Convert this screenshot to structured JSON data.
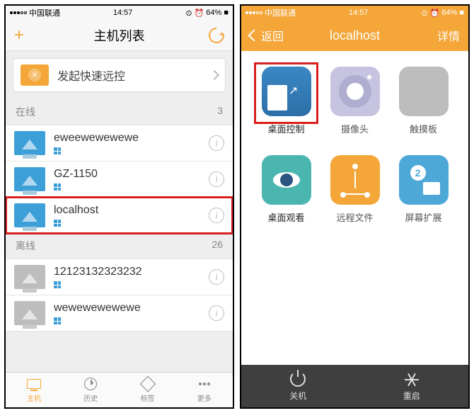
{
  "status": {
    "carrier": "中国联通",
    "time": "14:57",
    "battery": "64%"
  },
  "left": {
    "nav_title": "主机列表",
    "quick_label": "发起快速远控",
    "section_online": "在线",
    "count_online": "3",
    "section_offline": "离线",
    "count_offline": "26",
    "hosts_online": [
      {
        "name": "eweewewewewe"
      },
      {
        "name": "GZ-1150"
      },
      {
        "name": "localhost"
      }
    ],
    "hosts_offline": [
      {
        "name": "12123132323232"
      },
      {
        "name": "wewewewewewe"
      }
    ],
    "tabs": [
      {
        "label": "主机"
      },
      {
        "label": "历史"
      },
      {
        "label": "标签"
      },
      {
        "label": "更多"
      }
    ]
  },
  "right": {
    "back": "返回",
    "title": "localhost",
    "detail": "详情",
    "grid": [
      {
        "label": "桌面控制"
      },
      {
        "label": "摄像头"
      },
      {
        "label": "触摸板"
      },
      {
        "label": "桌面观看"
      },
      {
        "label": "远程文件"
      },
      {
        "label": "屏幕扩展"
      }
    ],
    "bottom": [
      {
        "label": "关机"
      },
      {
        "label": "重启"
      }
    ]
  }
}
